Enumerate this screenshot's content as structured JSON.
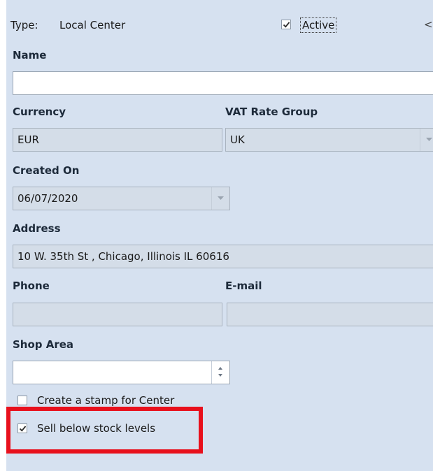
{
  "header": {
    "type_label": "Type:",
    "type_value": "Local Center",
    "active_label": "Active",
    "active_checked": true,
    "collapse_glyph": "<"
  },
  "fields": {
    "name_label": "Name",
    "name_value": "",
    "currency_label": "Currency",
    "currency_value": "EUR",
    "vat_label": "VAT Rate Group",
    "vat_value": "UK",
    "created_label": "Created On",
    "created_value": "06/07/2020",
    "address_label": "Address",
    "address_value": "10 W. 35th St , Chicago, Illinois IL 60616",
    "phone_label": "Phone",
    "phone_value": "",
    "email_label": "E-mail",
    "email_value": "",
    "shop_area_label": "Shop Area",
    "shop_area_value": ""
  },
  "options": {
    "stamp_label": "Create a stamp for Center",
    "stamp_checked": false,
    "sell_below_label": "Sell below stock levels",
    "sell_below_checked": true
  },
  "icons": [
    "checkmark-icon",
    "chevron-down-icon",
    "chevron-left-icon",
    "spin-up-icon",
    "spin-down-icon"
  ],
  "colors": {
    "panel_bg": "#d6e1f0",
    "highlight_border": "#e8101c"
  }
}
